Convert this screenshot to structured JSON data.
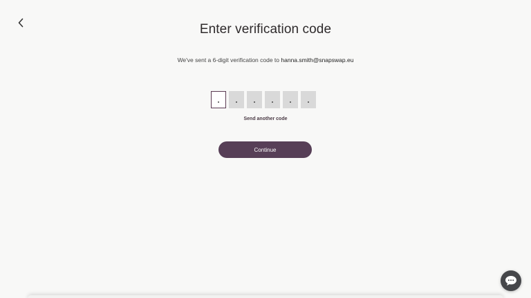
{
  "header": {
    "back_icon": "chevron-left-icon",
    "title": "Enter verification code"
  },
  "message": {
    "prefix": "We've sent a 6-digit verification code to ",
    "email": "hanna.smith@snapswap.eu"
  },
  "code_input": {
    "length": 6,
    "active_index": 0,
    "colors": {
      "active_border": "#5a3a52",
      "inactive_fill": "#d9d9d9"
    }
  },
  "resend_label": "Send another code",
  "continue_label": "Continue",
  "chat": {
    "icon": "chat-bubble-icon"
  },
  "colors": {
    "accent": "#573f57",
    "background": "#f8f8f7"
  }
}
